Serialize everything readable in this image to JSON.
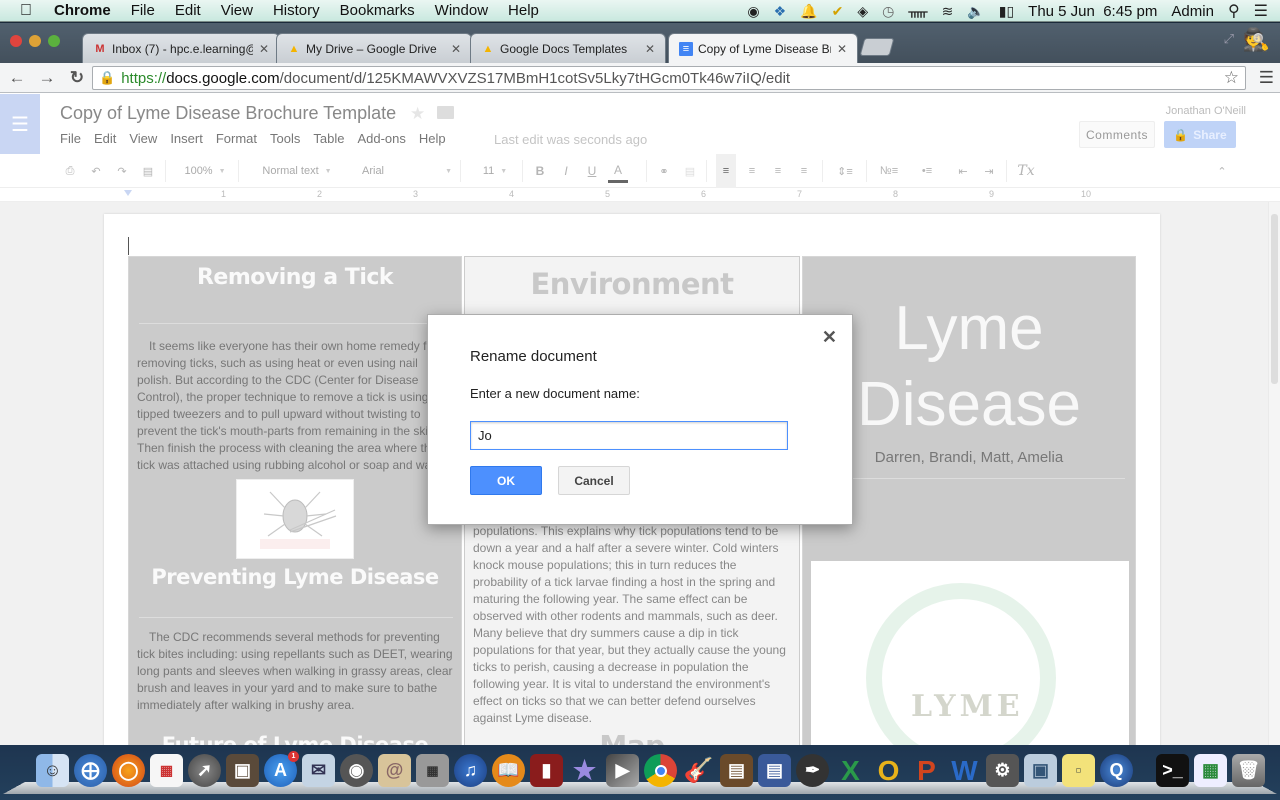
{
  "menubar": {
    "app_name": "Chrome",
    "menus": [
      "File",
      "Edit",
      "View",
      "History",
      "Bookmarks",
      "Window",
      "Help"
    ],
    "status_icons": [
      "record-icon",
      "dropbox-icon",
      "notification-bell-icon",
      "norton-check-icon",
      "layers-icon",
      "time-machine-icon",
      "bluetooth-icon",
      "wifi-icon",
      "volume-icon",
      "battery-icon"
    ],
    "clock": "Thu 5 Jun  6:45 pm",
    "user": "Admin"
  },
  "browser": {
    "tabs": [
      {
        "label": "Inbox (7) - hpc.e.learning@",
        "icon": "gmail-icon",
        "active": false
      },
      {
        "label": "My Drive – Google Drive",
        "icon": "drive-icon",
        "active": false
      },
      {
        "label": "Google Docs Templates",
        "icon": "drive-icon",
        "active": false
      },
      {
        "label": "Copy of Lyme Disease Broc",
        "icon": "docs-icon",
        "active": true
      }
    ],
    "url_scheme": "https://",
    "url_host": "docs.google.com",
    "url_path": "/document/d/125KMAWVXVZS17MBmH1cotSv5Lky7tHGcm0Tk46w7iIQ/edit"
  },
  "docs": {
    "title": "Copy of Lyme Disease Brochure Template",
    "menus": [
      "File",
      "Edit",
      "View",
      "Insert",
      "Format",
      "Tools",
      "Table",
      "Add-ons",
      "Help"
    ],
    "last_edit": "Last edit was seconds ago",
    "user_name": "Jonathan O'Neill",
    "comments_label": "Comments",
    "share_label": "Share",
    "toolbar": {
      "zoom": "100%",
      "style": "Normal text",
      "font": "Arial",
      "size": "11",
      "bold": "B",
      "italic": "I",
      "underline": "U",
      "text_color": "A",
      "clear_format": "Tx"
    },
    "ruler_ticks": [
      "1",
      "2",
      "3",
      "4",
      "5",
      "6",
      "7",
      "8",
      "9",
      "10"
    ]
  },
  "brochure": {
    "left": {
      "heading1": "Removing a Tick",
      "para1": "It seems like everyone has their own home remedy for removing ticks, such as using heat or even using nail polish. But according to the CDC (Center for Disease Control), the proper technique to remove a tick is using fine tipped tweezers and to pull upward without twisting to prevent  the tick's mouth-parts from remaining in the skin. Then finish the process with cleaning the area where the tick was attached using rubbing alcohol or soap and water.",
      "heading2": "Preventing Lyme Disease",
      "para2": "The CDC recommends several methods for preventing tick bites including: using repellants such as DEET, wearing long pants and sleeves when walking in grassy areas, clear brush and leaves in your yard and to make sure to bathe immediately after walking in brushy area.",
      "heading3": "Future of Lyme Disease"
    },
    "middle": {
      "heading1": "Environment",
      "para1": "populations. This explains why tick populations tend to be down a year and a half after a severe winter. Cold winters knock mouse populations; this in turn reduces the probability of a tick larvae finding a host in the spring and maturing the following year. The same effect can be observed with other rodents and mammals, such as deer. Many believe that dry summers cause a dip in tick populations for that year, but they actually cause the young ticks to perish, causing a decrease in population the following year. It is vital to understand the environment's effect on ticks so that we can better defend ourselves against Lyme disease.",
      "heading2": "Map"
    },
    "right": {
      "title_line1": "Lyme",
      "title_line2": "Disease",
      "authors": "Darren, Brandi, Matt, Amelia",
      "logo_text": "LYME"
    }
  },
  "dialog": {
    "title": "Rename document",
    "label": "Enter a new document name:",
    "input_value": "Jo",
    "ok_label": "OK",
    "cancel_label": "Cancel"
  },
  "dock": {
    "apps": [
      "Finder",
      "Safari",
      "Firefox",
      "Launchpad-Grid",
      "Rocket",
      "Photo Booth",
      "App Store",
      "Mail",
      "FaceTime",
      "Contacts",
      "Calculator",
      "iTunes",
      "iBooks",
      "Photo Slideshow",
      "iMovie",
      "Final Cut Pro",
      "Chrome",
      "GarageBand",
      "Keynote Podium",
      "Keynote",
      "Script Editor",
      "Excel",
      "Outlook",
      "PowerPoint",
      "Word",
      "System Preferences",
      "Preview",
      "Stickies",
      "QuickTime",
      "Terminal",
      "Numbers",
      "Trash"
    ],
    "appstore_badge": "1"
  }
}
